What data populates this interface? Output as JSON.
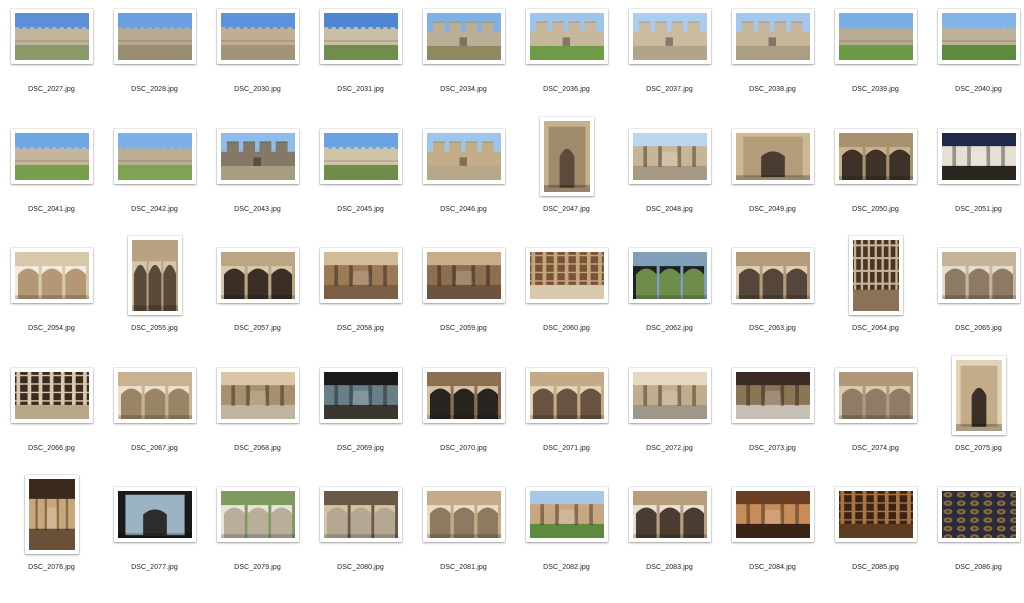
{
  "files": [
    {
      "name": "DSC_2027.jpg",
      "orientation": "landscape",
      "scene": "wall",
      "palette": {
        "sky": "#5b8fd8",
        "main": "#c2b49a",
        "ground": "#8a9a6a"
      }
    },
    {
      "name": "DSC_2028.jpg",
      "orientation": "landscape",
      "scene": "wall",
      "palette": {
        "sky": "#6a9ee0",
        "main": "#b8aa90",
        "ground": "#9a8e72"
      }
    },
    {
      "name": "DSC_2030.jpg",
      "orientation": "landscape",
      "scene": "wall",
      "palette": {
        "sky": "#5d93dc",
        "main": "#bfae92",
        "ground": "#a39478"
      }
    },
    {
      "name": "DSC_2031.jpg",
      "orientation": "landscape",
      "scene": "wall",
      "palette": {
        "sky": "#4f86d2",
        "main": "#c9bda4",
        "ground": "#6f8e4e"
      }
    },
    {
      "name": "DSC_2034.jpg",
      "orientation": "landscape",
      "scene": "tower",
      "palette": {
        "sky": "#7fb0e6",
        "main": "#bcae96",
        "ground": "#8d8a62"
      }
    },
    {
      "name": "DSC_2036.jpg",
      "orientation": "landscape",
      "scene": "tower",
      "palette": {
        "sky": "#9cc4ec",
        "main": "#c7b89c",
        "ground": "#6f9a46"
      }
    },
    {
      "name": "DSC_2037.jpg",
      "orientation": "landscape",
      "scene": "tower",
      "palette": {
        "sky": "#a8cdf0",
        "main": "#cbbba0",
        "ground": "#b0a58a"
      }
    },
    {
      "name": "DSC_2038.jpg",
      "orientation": "landscape",
      "scene": "tower",
      "palette": {
        "sky": "#a2c8ee",
        "main": "#c6b69a",
        "ground": "#aa9f85"
      }
    },
    {
      "name": "DSC_2039.jpg",
      "orientation": "landscape",
      "scene": "wall",
      "palette": {
        "sky": "#7aaee6",
        "main": "#b9ab92",
        "ground": "#6b9b44"
      }
    },
    {
      "name": "DSC_2040.jpg",
      "orientation": "landscape",
      "scene": "wall",
      "palette": {
        "sky": "#83b3e8",
        "main": "#bdb197",
        "ground": "#5d8a3c"
      }
    },
    {
      "name": "DSC_2041.jpg",
      "orientation": "landscape",
      "scene": "wall",
      "palette": {
        "sky": "#6fa6e4",
        "main": "#c4b69c",
        "ground": "#76a04c"
      }
    },
    {
      "name": "DSC_2042.jpg",
      "orientation": "landscape",
      "scene": "wall",
      "palette": {
        "sky": "#7cb0e8",
        "main": "#bcae94",
        "ground": "#7ea452"
      }
    },
    {
      "name": "DSC_2043.jpg",
      "orientation": "landscape",
      "scene": "tower",
      "palette": {
        "sky": "#8fbceb",
        "main": "#857866",
        "ground": "#a89c82"
      }
    },
    {
      "name": "DSC_2045.jpg",
      "orientation": "landscape",
      "scene": "wall",
      "palette": {
        "sky": "#6aa2e2",
        "main": "#cfc3a8",
        "ground": "#6d8d48"
      }
    },
    {
      "name": "DSC_2046.jpg",
      "orientation": "landscape",
      "scene": "tower",
      "palette": {
        "sky": "#9cc6ee",
        "main": "#c2ad88",
        "ground": "#b8a88a"
      }
    },
    {
      "name": "DSC_2047.jpg",
      "orientation": "portrait",
      "scene": "door",
      "palette": {
        "sky": "#c7b08c",
        "main": "#a08a6c",
        "ground": "#5c4a3a"
      }
    },
    {
      "name": "DSC_2048.jpg",
      "orientation": "landscape",
      "scene": "courtyard",
      "palette": {
        "sky": "#bdd6f0",
        "main": "#c8b596",
        "ground": "#a69a84"
      }
    },
    {
      "name": "DSC_2049.jpg",
      "orientation": "landscape",
      "scene": "door",
      "palette": {
        "sky": "#cdb894",
        "main": "#b39c7a",
        "ground": "#4a3c30"
      }
    },
    {
      "name": "DSC_2050.jpg",
      "orientation": "landscape",
      "scene": "arch",
      "palette": {
        "sky": "#c9b390",
        "main": "#a8916e",
        "ground": "#3e3228"
      }
    },
    {
      "name": "DSC_2051.jpg",
      "orientation": "landscape",
      "scene": "courtyard",
      "palette": {
        "sky": "#1e2a4a",
        "main": "#e6e0d4",
        "ground": "#2a2620"
      }
    },
    {
      "name": "DSC_2054.jpg",
      "orientation": "landscape",
      "scene": "arcade",
      "palette": {
        "sky": "#f2ece0",
        "main": "#d8c8aa",
        "ground": "#b49876"
      }
    },
    {
      "name": "DSC_2055.jpg",
      "orientation": "portrait",
      "scene": "arch",
      "palette": {
        "sky": "#d6c6a8",
        "main": "#b8a282",
        "ground": "#5a4a3a"
      }
    },
    {
      "name": "DSC_2057.jpg",
      "orientation": "landscape",
      "scene": "arch",
      "palette": {
        "sky": "#d9c9ac",
        "main": "#bba583",
        "ground": "#3a2e26"
      }
    },
    {
      "name": "DSC_2058.jpg",
      "orientation": "landscape",
      "scene": "hall",
      "palette": {
        "sky": "#d2bc98",
        "main": "#9c7a58",
        "ground": "#7a5e46"
      }
    },
    {
      "name": "DSC_2059.jpg",
      "orientation": "landscape",
      "scene": "hall",
      "palette": {
        "sky": "#c7ae8a",
        "main": "#8e6e50",
        "ground": "#6c5240"
      }
    },
    {
      "name": "DSC_2060.jpg",
      "orientation": "landscape",
      "scene": "ceiling",
      "palette": {
        "sky": "#7a5236",
        "main": "#c2a67e",
        "ground": "#d8c8ae"
      }
    },
    {
      "name": "DSC_2062.jpg",
      "orientation": "landscape",
      "scene": "arcade",
      "palette": {
        "sky": "#202020",
        "main": "#7fa0b8",
        "ground": "#6e8c4a"
      }
    },
    {
      "name": "DSC_2063.jpg",
      "orientation": "landscape",
      "scene": "arch",
      "palette": {
        "sky": "#e0d0b2",
        "main": "#b49c7a",
        "ground": "#54463a"
      }
    },
    {
      "name": "DSC_2064.jpg",
      "orientation": "portrait",
      "scene": "ceiling",
      "palette": {
        "sky": "#4a3424",
        "main": "#c8b494",
        "ground": "#8a7258"
      }
    },
    {
      "name": "DSC_2065.jpg",
      "orientation": "landscape",
      "scene": "arch",
      "palette": {
        "sky": "#e6dccc",
        "main": "#c6b49a",
        "ground": "#8c7a62"
      }
    },
    {
      "name": "DSC_2066.jpg",
      "orientation": "landscape",
      "scene": "ceiling",
      "palette": {
        "sky": "#3a2a20",
        "main": "#d8c8ac",
        "ground": "#b8a888"
      }
    },
    {
      "name": "DSC_2067.jpg",
      "orientation": "landscape",
      "scene": "arch",
      "palette": {
        "sky": "#ebe0ca",
        "main": "#c9b291",
        "ground": "#9a8466"
      }
    },
    {
      "name": "DSC_2068.jpg",
      "orientation": "landscape",
      "scene": "hall",
      "palette": {
        "sky": "#d8c6a6",
        "main": "#a8906e",
        "ground": "#c0b4a0"
      }
    },
    {
      "name": "DSC_2069.jpg",
      "orientation": "landscape",
      "scene": "hall",
      "palette": {
        "sky": "#1c1a18",
        "main": "#6a7e88",
        "ground": "#3a3630"
      }
    },
    {
      "name": "DSC_2070.jpg",
      "orientation": "landscape",
      "scene": "arch",
      "palette": {
        "sky": "#d6c2a0",
        "main": "#8c6e50",
        "ground": "#2a2420"
      }
    },
    {
      "name": "DSC_2071.jpg",
      "orientation": "landscape",
      "scene": "arch",
      "palette": {
        "sky": "#e2d4b8",
        "main": "#c4aa86",
        "ground": "#6a5240"
      }
    },
    {
      "name": "DSC_2072.jpg",
      "orientation": "landscape",
      "scene": "hall",
      "palette": {
        "sky": "#e4d8c2",
        "main": "#c2ac8c",
        "ground": "#9e9888"
      }
    },
    {
      "name": "DSC_2073.jpg",
      "orientation": "landscape",
      "scene": "hall",
      "palette": {
        "sky": "#3a2c22",
        "main": "#8c7456",
        "ground": "#c6c0b4"
      }
    },
    {
      "name": "DSC_2074.jpg",
      "orientation": "landscape",
      "scene": "arch",
      "palette": {
        "sky": "#dccab0",
        "main": "#b09878",
        "ground": "#8e7c66"
      }
    },
    {
      "name": "DSC_2075.jpg",
      "orientation": "portrait",
      "scene": "door",
      "palette": {
        "sky": "#e2d2b6",
        "main": "#c4ac88",
        "ground": "#3a3028"
      }
    },
    {
      "name": "DSC_2076.jpg",
      "orientation": "portrait",
      "scene": "hall",
      "palette": {
        "sky": "#3a2a1e",
        "main": "#c8a878",
        "ground": "#6a5038"
      }
    },
    {
      "name": "DSC_2077.jpg",
      "orientation": "landscape",
      "scene": "door",
      "palette": {
        "sky": "#1a1a1a",
        "main": "#9ab4c4",
        "ground": "#2c2c2c"
      }
    },
    {
      "name": "DSC_2079.jpg",
      "orientation": "landscape",
      "scene": "arcade",
      "palette": {
        "sky": "#e8e4da",
        "main": "#7e9a5e",
        "ground": "#b8ae9a"
      }
    },
    {
      "name": "DSC_2080.jpg",
      "orientation": "landscape",
      "scene": "arch",
      "palette": {
        "sky": "#d4c4a6",
        "main": "#6c5a48",
        "ground": "#b4a892"
      }
    },
    {
      "name": "DSC_2081.jpg",
      "orientation": "landscape",
      "scene": "arch",
      "palette": {
        "sky": "#eadcc2",
        "main": "#c4ac88",
        "ground": "#8e7a60"
      }
    },
    {
      "name": "DSC_2082.jpg",
      "orientation": "landscape",
      "scene": "garden",
      "palette": {
        "sky": "#a8c8ea",
        "main": "#c8a682",
        "ground": "#5e8a3e"
      }
    },
    {
      "name": "DSC_2083.jpg",
      "orientation": "landscape",
      "scene": "arcade",
      "palette": {
        "sky": "#e8e2d6",
        "main": "#b89e7c",
        "ground": "#4a3c30"
      }
    },
    {
      "name": "DSC_2084.jpg",
      "orientation": "landscape",
      "scene": "hall",
      "palette": {
        "sky": "#6a3e24",
        "main": "#c88c58",
        "ground": "#3a2418"
      }
    },
    {
      "name": "DSC_2085.jpg",
      "orientation": "landscape",
      "scene": "ceiling",
      "palette": {
        "sky": "#3a2416",
        "main": "#a87444",
        "ground": "#5e3c22"
      }
    },
    {
      "name": "DSC_2086.jpg",
      "orientation": "landscape",
      "scene": "pattern",
      "palette": {
        "sky": "#2a2c3c",
        "main": "#8c6c3c",
        "ground": "#4c3e30"
      }
    }
  ]
}
